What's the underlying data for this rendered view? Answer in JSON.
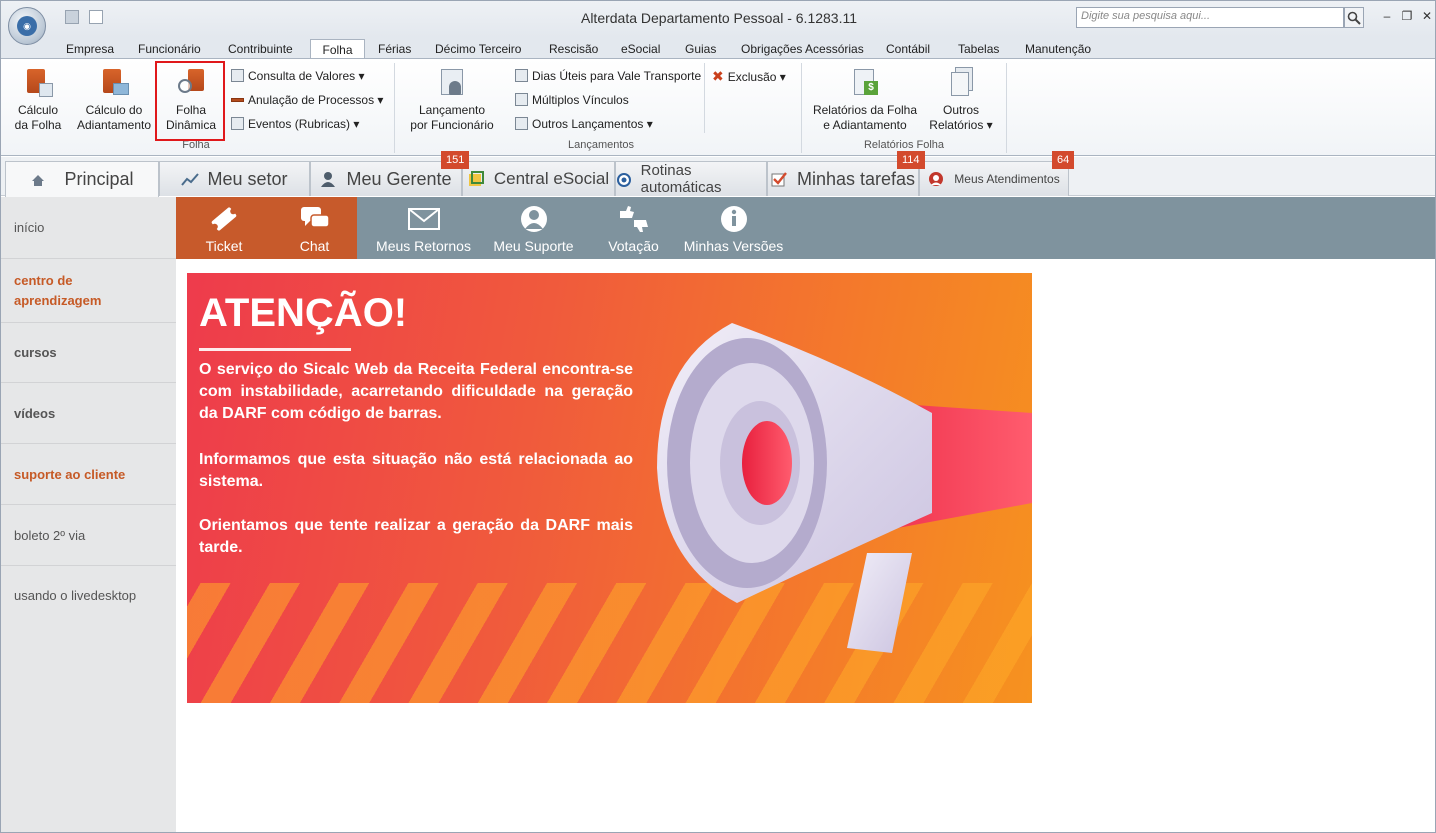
{
  "window": {
    "title": "Alterdata Departamento Pessoal - 6.1283.11",
    "search_placeholder": "Digite sua pesquisa aqui..."
  },
  "ribbon_tabs": [
    "Empresa",
    "Funcionário",
    "Contribuinte",
    "Folha",
    "Férias",
    "Décimo Terceiro",
    "Rescisão",
    "eSocial",
    "Guias",
    "Obrigações Acessórias",
    "Contábil",
    "Tabelas",
    "Manutenção"
  ],
  "ribbon": {
    "folha_group": {
      "label": "Folha",
      "calculo_folha": [
        "Cálculo",
        "da Folha"
      ],
      "calculo_adiantamento": [
        "Cálculo do",
        "Adiantamento"
      ],
      "folha_dinamica": [
        "Folha",
        "Dinâmica"
      ],
      "consulta_valores": "Consulta de Valores",
      "anulacao_processos": "Anulação de Processos",
      "eventos_rubricas": "Eventos (Rubricas)"
    },
    "lancamentos_group": {
      "label": "Lançamentos",
      "lancamento_funcionario": [
        "Lançamento",
        "por Funcionário"
      ],
      "dias_uteis": "Dias Úteis para Vale Transporte",
      "multiplos_vinculos": "Múltiplos Vínculos",
      "outros_lancamentos": "Outros Lançamentos",
      "exclusao": "Exclusão"
    },
    "relatorios_group": {
      "label": "Relatórios Folha",
      "relatorios_folha": [
        "Relatórios da Folha",
        "e Adiantamento"
      ],
      "outros_relatorios": [
        "Outros",
        "Relatórios"
      ]
    }
  },
  "doc_tabs": [
    {
      "label": "Principal"
    },
    {
      "label": "Meu setor"
    },
    {
      "label": "Meu Gerente",
      "badge": "151"
    },
    {
      "label": "Central eSocial"
    },
    {
      "label": "Rotinas automáticas"
    },
    {
      "label": "Minhas tarefas",
      "badge": "114"
    },
    {
      "label": "Meus Atendimentos",
      "badge": "64"
    }
  ],
  "left_nav": [
    "início",
    "centro de aprendizagem",
    "cursos",
    "vídeos",
    "suporte ao cliente",
    "boleto 2º via",
    "usando o livedesktop"
  ],
  "icon_bar": [
    "Ticket",
    "Chat",
    "Meus Retornos",
    "Meu Suporte",
    "Votação",
    "Minhas Versões"
  ],
  "banner": {
    "title": "ATENÇÃO!",
    "paragraphs": [
      "O serviço do Sicalc Web da Receita Federal encontra-se com instabilidade, acarretando dificuldade na geração da DARF com código de barras.",
      "Informamos que esta situação não está relacionada ao sistema.",
      "Orientamos que tente realizar a geração da DARF mais tarde."
    ]
  },
  "colors": {
    "accent_orange": "#c75a2b",
    "bar_gray": "#7f939e",
    "badge_red": "#d34a2d",
    "highlight_red": "#e0181b"
  }
}
